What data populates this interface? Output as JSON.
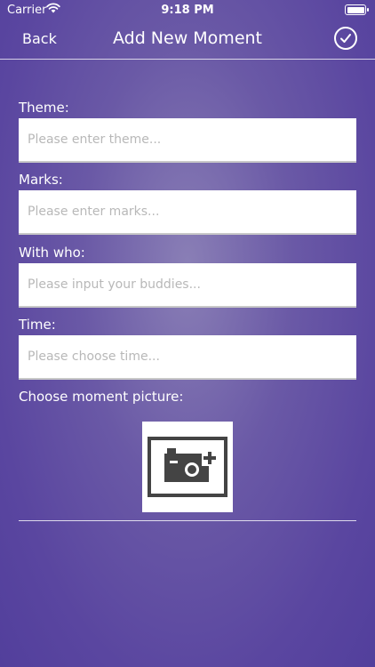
{
  "status_bar": {
    "carrier": "Carrier",
    "time": "9:18 PM"
  },
  "nav": {
    "back_label": "Back",
    "title": "Add New Moment"
  },
  "form": {
    "theme": {
      "label": "Theme:",
      "placeholder": "Please enter theme...",
      "value": ""
    },
    "marks": {
      "label": "Marks:",
      "placeholder": "Please enter marks...",
      "value": ""
    },
    "with_who": {
      "label": "With who:",
      "placeholder": "Please input your buddies...",
      "value": ""
    },
    "time": {
      "label": "Time:",
      "placeholder": "Please choose time...",
      "value": ""
    },
    "picture": {
      "label": "Choose moment picture:",
      "icon": "add-photo-camera-icon"
    }
  },
  "colors": {
    "background_top": "#8a7fb6",
    "background_bottom": "#523f9c",
    "text": "#ffffff",
    "placeholder": "#b8b8b8"
  }
}
